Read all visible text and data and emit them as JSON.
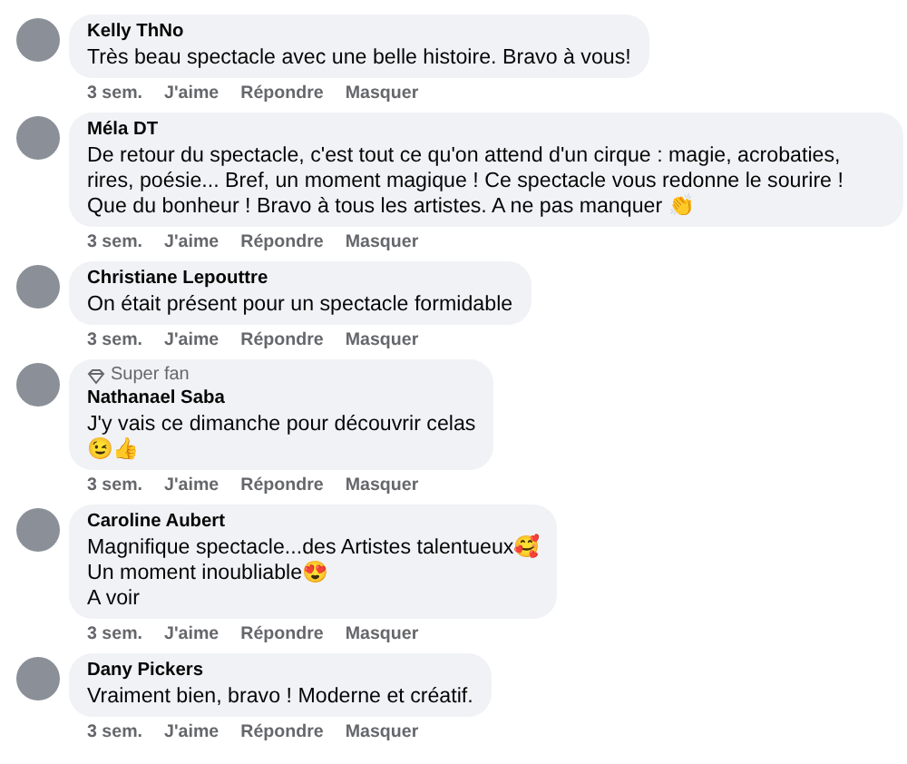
{
  "comments": [
    {
      "author": "Kelly ThNo",
      "lines": [
        "Très beau spectacle avec une belle histoire. Bravo à vous!"
      ],
      "time": "3 sem.",
      "actions": [
        "J'aime",
        "Répondre",
        "Masquer"
      ]
    },
    {
      "author": "Méla DT",
      "lines": [
        "De retour du spectacle, c'est tout ce qu'on attend d'un cirque : magie, acrobaties, rires, poésie... Bref, un moment magique ! Ce spectacle vous redonne le sourire ! Que du bonheur ! Bravo à tous les artistes. A ne pas manquer 👏"
      ],
      "time": "3 sem.",
      "actions": [
        "J'aime",
        "Répondre",
        "Masquer"
      ]
    },
    {
      "author": "Christiane Lepouttre",
      "lines": [
        "On était présent pour un spectacle formidable"
      ],
      "time": "3 sem.",
      "actions": [
        "J'aime",
        "Répondre",
        "Masquer"
      ]
    },
    {
      "badge": "Super fan",
      "author": "Nathanael Saba",
      "lines": [
        "J'y vais ce dimanche pour découvrir celas",
        "😉👍"
      ],
      "time": "3 sem.",
      "actions": [
        "J'aime",
        "Répondre",
        "Masquer"
      ]
    },
    {
      "author": "Caroline Aubert",
      "lines": [
        "Magnifique spectacle...des Artistes talentueux🥰",
        "Un moment inoubliable😍",
        "A voir"
      ],
      "time": "3 sem.",
      "actions": [
        "J'aime",
        "Répondre",
        "Masquer"
      ]
    },
    {
      "author": "Dany Pickers",
      "lines": [
        "Vraiment bien, bravo ! Moderne et créatif."
      ],
      "time": "3 sem.",
      "actions": [
        "J'aime",
        "Répondre",
        "Masquer"
      ]
    }
  ]
}
